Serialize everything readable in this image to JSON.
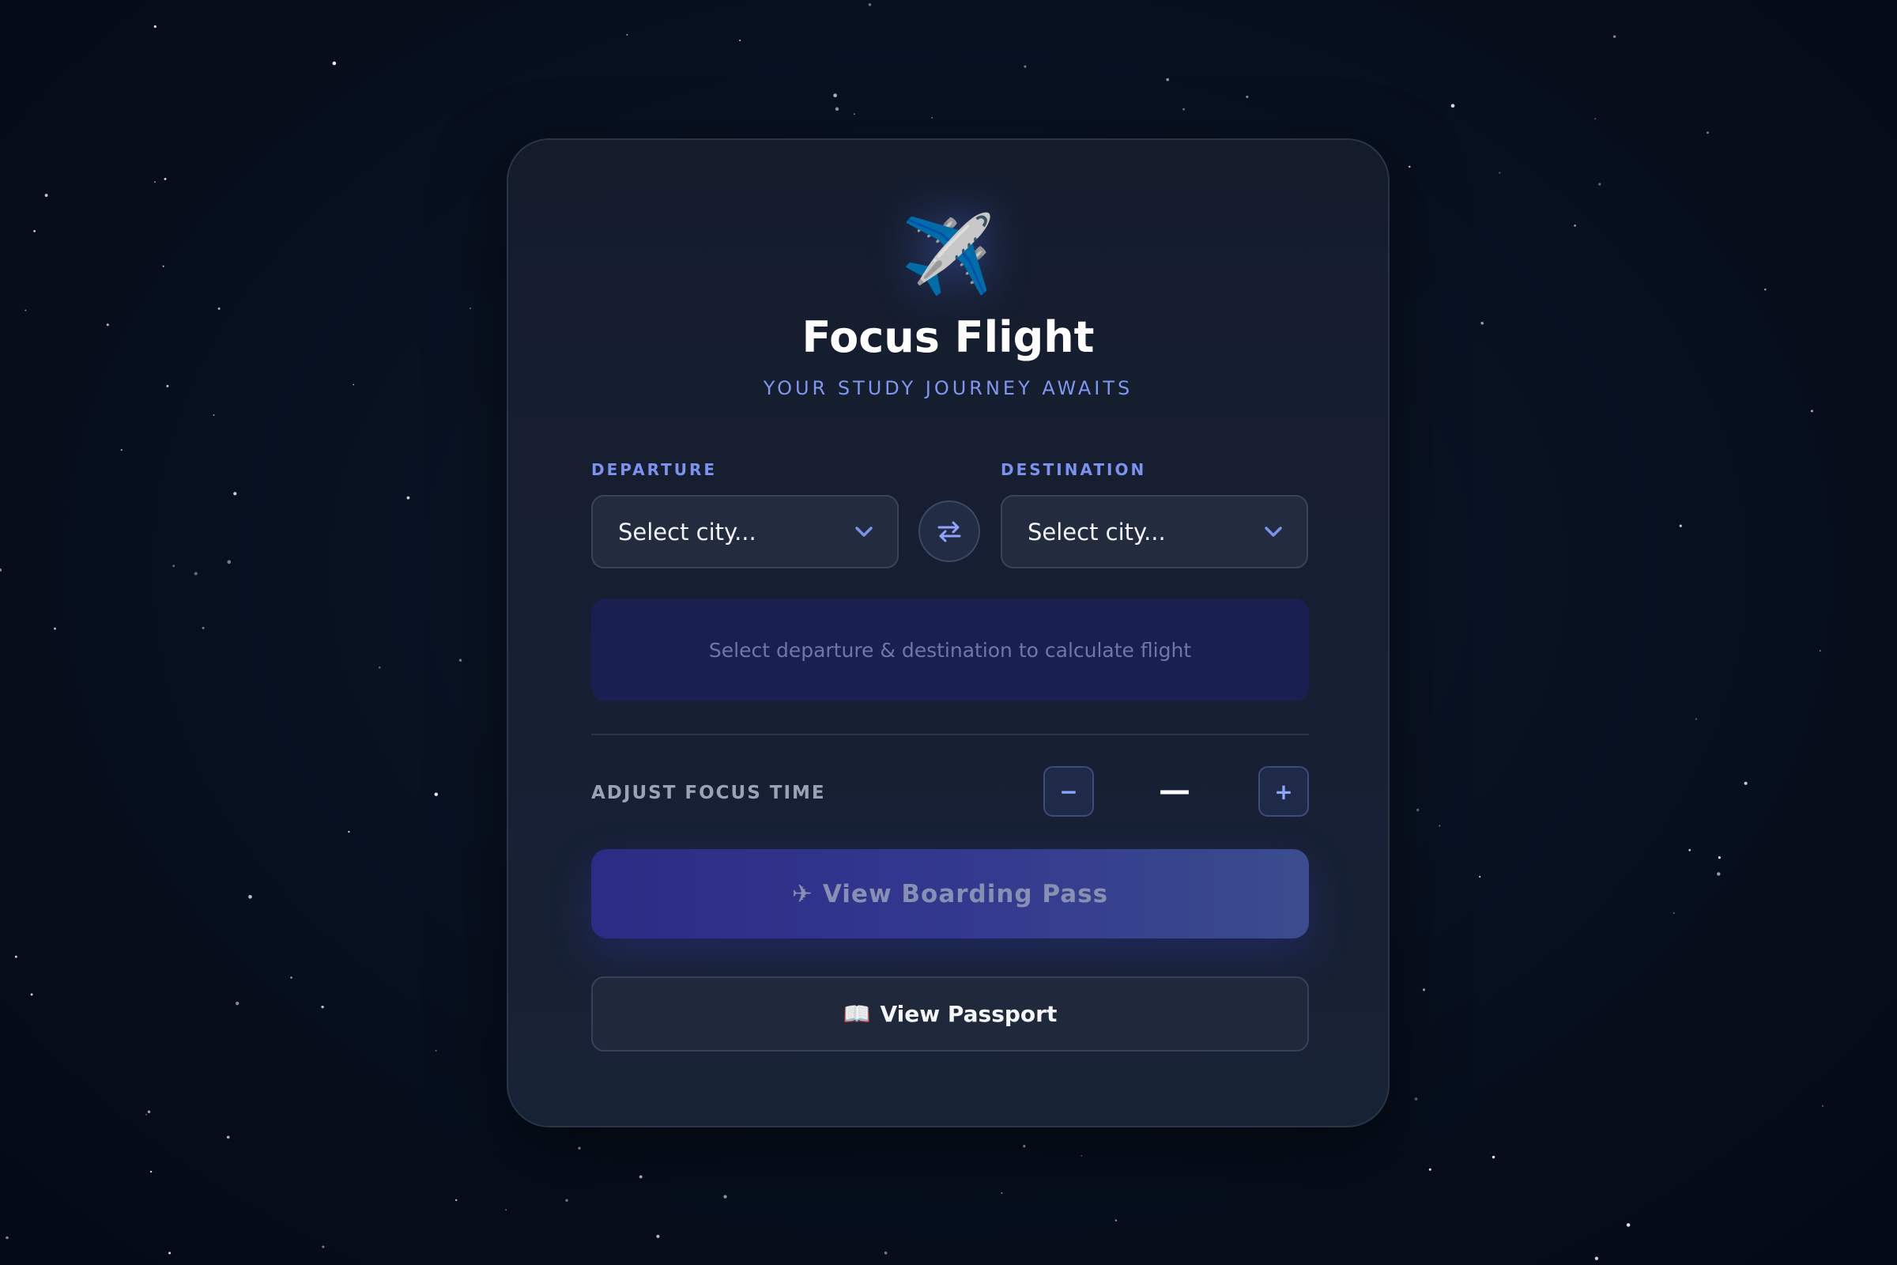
{
  "app": {
    "plane_emoji": "✈️",
    "title": "Focus Flight",
    "subtitle": "YOUR STUDY JOURNEY AWAITS"
  },
  "route": {
    "departure_label": "DEPARTURE",
    "departure_value": "Select city...",
    "destination_label": "DESTINATION",
    "destination_value": "Select city...",
    "swap_icon": "swap-arrows-icon",
    "info_text": "Select departure & destination to calculate flight"
  },
  "focus": {
    "label": "ADJUST FOCUS TIME",
    "decrement": "−",
    "value": "—",
    "increment": "+"
  },
  "actions": {
    "boarding_glyph": "✈",
    "boarding_label": "View Boarding Pass",
    "passport_glyph": "📖",
    "passport_label": "View Passport"
  },
  "colors": {
    "accent": "#7c92ee",
    "card_bg": "#172033",
    "info_bg": "#1a1f52",
    "primary_button": "#2c2b85"
  }
}
